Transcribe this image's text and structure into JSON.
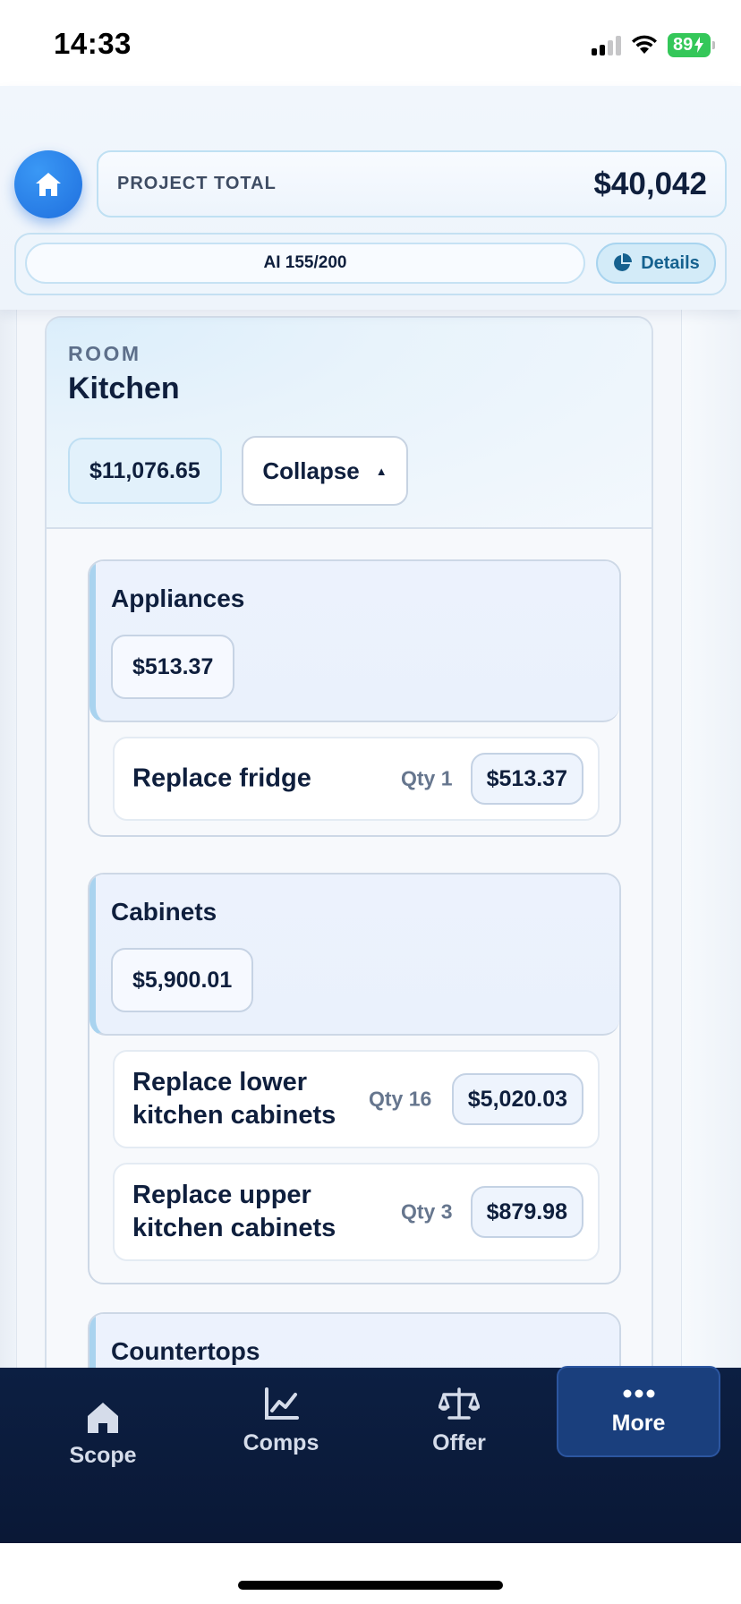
{
  "status_bar": {
    "time": "14:33",
    "battery": "89"
  },
  "header": {
    "total_label": "PROJECT TOTAL",
    "total_value": "$40,042",
    "ai_usage": "AI 155/200",
    "details_label": "Details"
  },
  "room": {
    "kicker": "ROOM",
    "name": "Kitchen",
    "total": "$11,076.65",
    "collapse_label": "Collapse",
    "categories": [
      {
        "name": "Appliances",
        "total": "$513.37",
        "items": [
          {
            "name": "Replace fridge",
            "qty": "Qty 1",
            "price": "$513.37"
          }
        ]
      },
      {
        "name": "Cabinets",
        "total": "$5,900.01",
        "items": [
          {
            "name": "Replace lower kitchen cabinets",
            "qty": "Qty 16",
            "price": "$5,020.03"
          },
          {
            "name": "Replace upper kitchen cabinets",
            "qty": "Qty 3",
            "price": "$879.98"
          }
        ]
      },
      {
        "name": "Countertops"
      }
    ]
  },
  "bottom_nav": {
    "items": [
      {
        "label": "Scope",
        "icon": "home-icon"
      },
      {
        "label": "Comps",
        "icon": "chart-line-icon"
      },
      {
        "label": "Offer",
        "icon": "scale-icon"
      },
      {
        "label": "More",
        "icon": "ellipsis-icon",
        "active": true
      }
    ]
  },
  "colors": {
    "accent": "#1f6fde",
    "nav_bg": "#0c1f42",
    "nav_active": "#1a3f7d",
    "text_primary": "#0f1f3d"
  }
}
